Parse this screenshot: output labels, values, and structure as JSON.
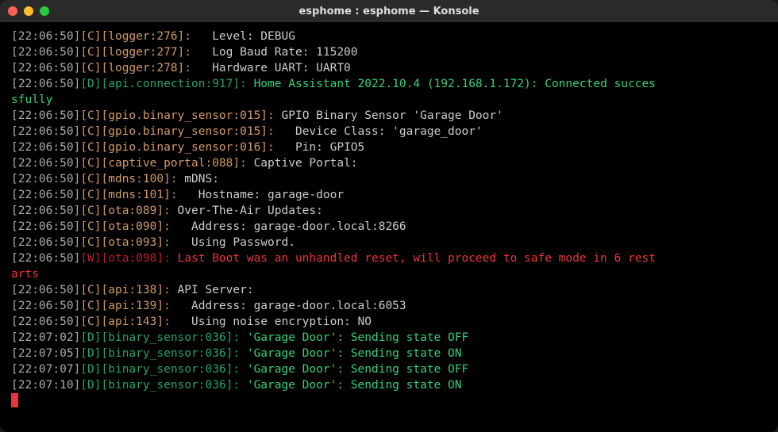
{
  "window": {
    "title": "esphome : esphome — Konsole"
  },
  "log_lines": [
    {
      "ts": "[22:06:50]",
      "lvl": "C",
      "tag": "[logger:276]",
      "msg": "  Level: DEBUG"
    },
    {
      "ts": "[22:06:50]",
      "lvl": "C",
      "tag": "[logger:277]",
      "msg": "  Log Baud Rate: 115200"
    },
    {
      "ts": "[22:06:50]",
      "lvl": "C",
      "tag": "[logger:278]",
      "msg": "  Hardware UART: UART0"
    },
    {
      "ts": "[22:06:50]",
      "lvl": "D",
      "tag": "[api.connection:917]",
      "msg": "Home Assistant 2022.10.4 (192.168.1.172): Connected succes"
    },
    {
      "cont": true,
      "lvl": "D",
      "msg": "sfully"
    },
    {
      "ts": "[22:06:50]",
      "lvl": "C",
      "tag": "[gpio.binary_sensor:015]",
      "msg": "GPIO Binary Sensor 'Garage Door'"
    },
    {
      "ts": "[22:06:50]",
      "lvl": "C",
      "tag": "[gpio.binary_sensor:015]",
      "msg": "  Device Class: 'garage_door'"
    },
    {
      "ts": "[22:06:50]",
      "lvl": "C",
      "tag": "[gpio.binary_sensor:016]",
      "msg": "  Pin: GPIO5"
    },
    {
      "ts": "[22:06:50]",
      "lvl": "C",
      "tag": "[captive_portal:088]",
      "msg": "Captive Portal:"
    },
    {
      "ts": "[22:06:50]",
      "lvl": "C",
      "tag": "[mdns:100]",
      "msg": "mDNS:"
    },
    {
      "ts": "[22:06:50]",
      "lvl": "C",
      "tag": "[mdns:101]",
      "msg": "  Hostname: garage-door"
    },
    {
      "ts": "[22:06:50]",
      "lvl": "C",
      "tag": "[ota:089]",
      "msg": "Over-The-Air Updates:"
    },
    {
      "ts": "[22:06:50]",
      "lvl": "C",
      "tag": "[ota:090]",
      "msg": "  Address: garage-door.local:8266"
    },
    {
      "ts": "[22:06:50]",
      "lvl": "C",
      "tag": "[ota:093]",
      "msg": "  Using Password."
    },
    {
      "ts": "[22:06:50]",
      "lvl": "W",
      "tag": "[ota:098]",
      "msg": "Last Boot was an unhandled reset, will proceed to safe mode in 6 rest"
    },
    {
      "cont": true,
      "lvl": "W",
      "msg": "arts"
    },
    {
      "ts": "[22:06:50]",
      "lvl": "C",
      "tag": "[api:138]",
      "msg": "API Server:"
    },
    {
      "ts": "[22:06:50]",
      "lvl": "C",
      "tag": "[api:139]",
      "msg": "  Address: garage-door.local:6053"
    },
    {
      "ts": "[22:06:50]",
      "lvl": "C",
      "tag": "[api:143]",
      "msg": "  Using noise encryption: NO"
    },
    {
      "ts": "[22:07:02]",
      "lvl": "D",
      "tag": "[binary_sensor:036]",
      "msg": "'Garage Door': Sending state OFF"
    },
    {
      "ts": "[22:07:05]",
      "lvl": "D",
      "tag": "[binary_sensor:036]",
      "msg": "'Garage Door': Sending state ON"
    },
    {
      "ts": "[22:07:07]",
      "lvl": "D",
      "tag": "[binary_sensor:036]",
      "msg": "'Garage Door': Sending state OFF"
    },
    {
      "ts": "[22:07:10]",
      "lvl": "D",
      "tag": "[binary_sensor:036]",
      "msg": "'Garage Door': Sending state ON"
    }
  ]
}
